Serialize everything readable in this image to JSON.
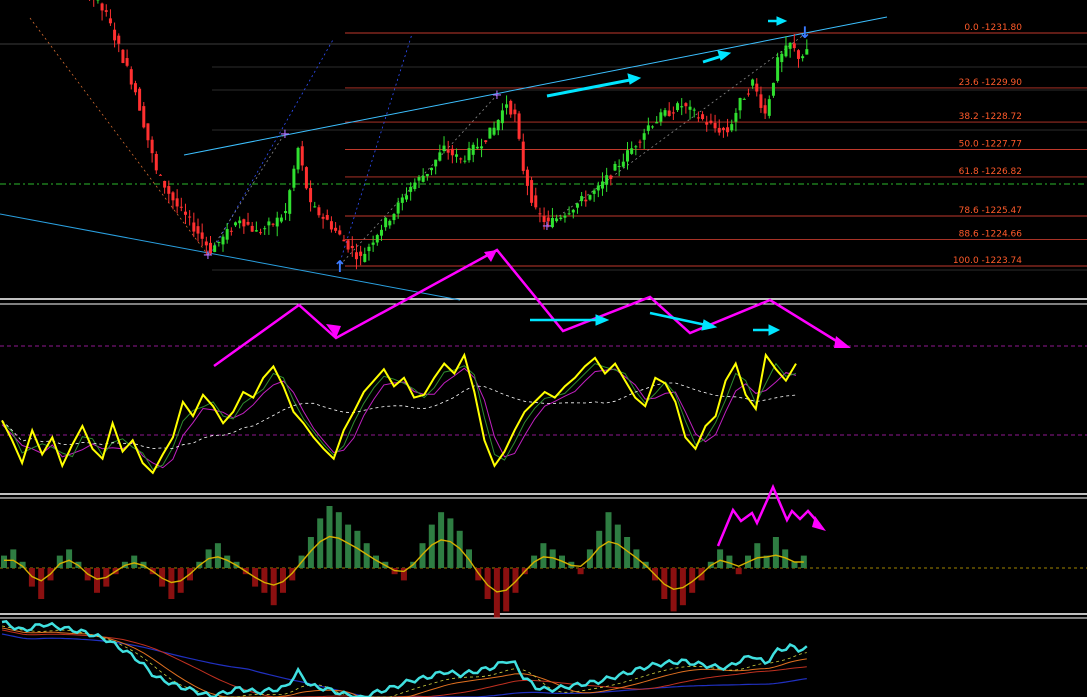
{
  "chart_data": [
    {
      "type": "candlestick",
      "panel": "price",
      "title": "",
      "fibonacci_levels": [
        {
          "label": "0.0 -1231.80",
          "value": 1231.8
        },
        {
          "label": "23.6 -1229.90",
          "value": 1229.9
        },
        {
          "label": "38.2 -1228.72",
          "value": 1228.72
        },
        {
          "label": "50.0 -1227.77",
          "value": 1227.77
        },
        {
          "label": "61.8 -1226.82",
          "value": 1226.82
        },
        {
          "label": "78.6 -1225.47",
          "value": 1225.47
        },
        {
          "label": "88.6 -1224.66",
          "value": 1224.66
        },
        {
          "label": "100.0 -1223.74",
          "value": 1223.74
        }
      ],
      "price_path": [
        [
          0,
          1234.9
        ],
        [
          5,
          1233.7
        ],
        [
          10,
          1234.6
        ],
        [
          15,
          1234.0
        ],
        [
          20,
          1233.4
        ],
        [
          25,
          1232.4
        ],
        [
          28,
          1231.3
        ],
        [
          32,
          1229.8
        ],
        [
          37,
          1227.0
        ],
        [
          42,
          1225.8
        ],
        [
          47,
          1224.9
        ],
        [
          50,
          1224.3
        ],
        [
          53,
          1224.7
        ],
        [
          57,
          1225.4
        ],
        [
          61,
          1224.9
        ],
        [
          65,
          1225.2
        ],
        [
          68,
          1225.6
        ],
        [
          71,
          1227.8
        ],
        [
          74,
          1225.8
        ],
        [
          78,
          1225.3
        ],
        [
          82,
          1224.6
        ],
        [
          86,
          1224.0
        ],
        [
          90,
          1224.9
        ],
        [
          94,
          1225.6
        ],
        [
          98,
          1226.5
        ],
        [
          102,
          1227.0
        ],
        [
          106,
          1227.8
        ],
        [
          110,
          1227.4
        ],
        [
          114,
          1227.9
        ],
        [
          118,
          1228.5
        ],
        [
          121,
          1229.4
        ],
        [
          123,
          1228.9
        ],
        [
          125,
          1227.1
        ],
        [
          128,
          1225.6
        ],
        [
          131,
          1225.2
        ],
        [
          135,
          1225.6
        ],
        [
          139,
          1226.0
        ],
        [
          143,
          1226.4
        ],
        [
          147,
          1227.1
        ],
        [
          151,
          1227.8
        ],
        [
          155,
          1228.6
        ],
        [
          159,
          1229.0
        ],
        [
          163,
          1229.3
        ],
        [
          167,
          1228.9
        ],
        [
          171,
          1228.5
        ],
        [
          174,
          1228.4
        ],
        [
          177,
          1229.4
        ],
        [
          180,
          1230.1
        ],
        [
          183,
          1229.0
        ],
        [
          186,
          1230.8
        ],
        [
          189,
          1231.4
        ],
        [
          191,
          1231.0
        ],
        [
          193,
          1231.1
        ]
      ],
      "trend_lines": [
        {
          "name": "upper channel",
          "color": "#3cc0ff"
        },
        {
          "name": "lower channel",
          "color": "#2aa0e0"
        }
      ],
      "marks": [
        "swing-low",
        "swing-high",
        "swing-low",
        "swing-high",
        "swing-low",
        "swing-high"
      ]
    },
    {
      "type": "line",
      "panel": "oscillator",
      "title": "",
      "series": [
        {
          "color": "#ffff00"
        },
        {
          "color": "#2e8b2e"
        },
        {
          "color": "#c020c0"
        },
        {
          "color": "#ffffff",
          "style": "dashed"
        }
      ],
      "values": [
        {
          "v": 0.42
        },
        {
          "v": 0.28
        },
        {
          "v": 0.12
        },
        {
          "v": 0.35
        },
        {
          "v": 0.18
        },
        {
          "v": 0.3
        },
        {
          "v": 0.1
        },
        {
          "v": 0.25
        },
        {
          "v": 0.38
        },
        {
          "v": 0.22
        },
        {
          "v": 0.15
        },
        {
          "v": 0.4
        },
        {
          "v": 0.2
        },
        {
          "v": 0.28
        },
        {
          "v": 0.12
        },
        {
          "v": 0.05
        },
        {
          "v": 0.18
        },
        {
          "v": 0.3
        },
        {
          "v": 0.55
        },
        {
          "v": 0.45
        },
        {
          "v": 0.6
        },
        {
          "v": 0.52
        },
        {
          "v": 0.4
        },
        {
          "v": 0.48
        },
        {
          "v": 0.62
        },
        {
          "v": 0.58
        },
        {
          "v": 0.72
        },
        {
          "v": 0.8
        },
        {
          "v": 0.66
        },
        {
          "v": 0.48
        },
        {
          "v": 0.4
        },
        {
          "v": 0.3
        },
        {
          "v": 0.22
        },
        {
          "v": 0.15
        },
        {
          "v": 0.35
        },
        {
          "v": 0.48
        },
        {
          "v": 0.62
        },
        {
          "v": 0.7
        },
        {
          "v": 0.78
        },
        {
          "v": 0.66
        },
        {
          "v": 0.72
        },
        {
          "v": 0.58
        },
        {
          "v": 0.6
        },
        {
          "v": 0.72
        },
        {
          "v": 0.82
        },
        {
          "v": 0.75
        },
        {
          "v": 0.88
        },
        {
          "v": 0.62
        },
        {
          "v": 0.28
        },
        {
          "v": 0.1
        },
        {
          "v": 0.2
        },
        {
          "v": 0.35
        },
        {
          "v": 0.48
        },
        {
          "v": 0.55
        },
        {
          "v": 0.62
        },
        {
          "v": 0.58
        },
        {
          "v": 0.66
        },
        {
          "v": 0.72
        },
        {
          "v": 0.8
        },
        {
          "v": 0.86
        },
        {
          "v": 0.75
        },
        {
          "v": 0.82
        },
        {
          "v": 0.7
        },
        {
          "v": 0.58
        },
        {
          "v": 0.52
        },
        {
          "v": 0.72
        },
        {
          "v": 0.68
        },
        {
          "v": 0.55
        },
        {
          "v": 0.3
        },
        {
          "v": 0.22
        },
        {
          "v": 0.38
        },
        {
          "v": 0.45
        },
        {
          "v": 0.7
        },
        {
          "v": 0.82
        },
        {
          "v": 0.6
        },
        {
          "v": 0.5
        },
        {
          "v": 0.88
        },
        {
          "v": 0.78
        },
        {
          "v": 0.7
        },
        {
          "v": 0.82
        }
      ],
      "levels": [
        "upper dashed level",
        "lower dashed level"
      ]
    },
    {
      "type": "bar",
      "panel": "histogram",
      "title": "",
      "colors": {
        "positive": "#2e7d42",
        "negative": "#8b1010",
        "signal": "#d4b000"
      },
      "values": [
        0.2,
        0.3,
        0.1,
        -0.3,
        -0.5,
        -0.2,
        0.2,
        0.3,
        0.1,
        -0.2,
        -0.4,
        -0.3,
        -0.1,
        0.1,
        0.2,
        0.1,
        -0.1,
        -0.3,
        -0.5,
        -0.4,
        -0.2,
        0.1,
        0.3,
        0.4,
        0.2,
        0.1,
        -0.1,
        -0.3,
        -0.4,
        -0.6,
        -0.4,
        -0.2,
        0.2,
        0.5,
        0.8,
        1.0,
        0.9,
        0.7,
        0.6,
        0.4,
        0.2,
        0.1,
        -0.1,
        -0.2,
        0.1,
        0.4,
        0.7,
        0.9,
        0.8,
        0.6,
        0.3,
        -0.2,
        -0.5,
        -0.8,
        -0.7,
        -0.4,
        -0.1,
        0.2,
        0.4,
        0.3,
        0.2,
        0.1,
        -0.1,
        0.3,
        0.6,
        0.9,
        0.7,
        0.5,
        0.3,
        0.1,
        -0.2,
        -0.5,
        -0.7,
        -0.6,
        -0.4,
        -0.2,
        0.1,
        0.3,
        0.2,
        -0.1,
        0.2,
        0.4,
        0.2,
        0.5,
        0.3,
        0.1,
        0.2
      ]
    },
    {
      "type": "line",
      "panel": "moving-averages",
      "title": "",
      "series": [
        {
          "color": "#40e0e0"
        },
        {
          "color": "#e07020"
        },
        {
          "color": "#c03020"
        },
        {
          "color": "#2030c0"
        },
        {
          "color": "#d0d040",
          "style": "dashed"
        }
      ]
    }
  ],
  "annotations": {
    "arrow_colors": {
      "magenta": "#ff00ff",
      "cyan": "#00e5ff"
    }
  }
}
